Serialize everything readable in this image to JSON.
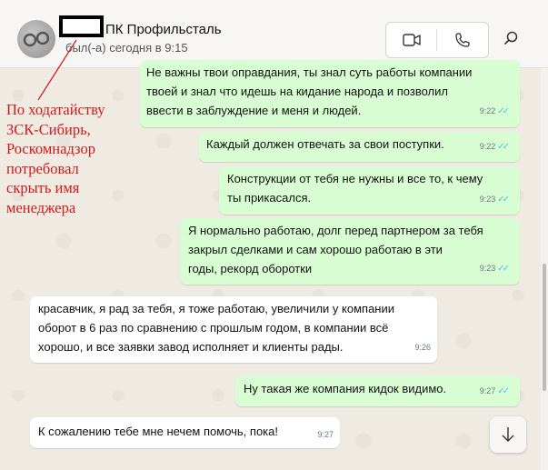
{
  "header": {
    "contact_name": "ПК Профильсталь",
    "status": "был(-а) сегодня в 9:15",
    "icons": [
      "video-call-icon",
      "voice-call-icon",
      "search-icon"
    ]
  },
  "annotation": {
    "lines": [
      "По ходатайству",
      "ЗСК-Сибирь,",
      "Роскомнадзор",
      "потребовал",
      "скрыть имя",
      "менеджера"
    ],
    "color": "#d11a1a"
  },
  "messages": [
    {
      "direction": "out",
      "lines": [
        "Не важны твои оправдания, ты знал суть работы компании",
        "твоей и знал что идешь на кидание народа и позволил",
        "ввести  в заблуждение и меня и людей."
      ],
      "time": "9:22",
      "ticks": "✓✓"
    },
    {
      "direction": "out",
      "lines": [
        "Каждый должен отвечать за свои поступки."
      ],
      "time": "9:22",
      "ticks": "✓✓"
    },
    {
      "direction": "out",
      "lines": [
        "Конструкции от тебя не нужны и все то, к чему",
        "ты прикасался."
      ],
      "time": "9:23",
      "ticks": "✓✓"
    },
    {
      "direction": "out",
      "lines": [
        "Я нормально работаю, долг перед партнером за тебя",
        "закрыл сделками и сам хорошо работаю в эти",
        "годы, рекорд оборотки"
      ],
      "time": "9:23",
      "ticks": "✓✓"
    },
    {
      "direction": "in",
      "lines": [
        "красавчик, я рад за тебя, я тоже работаю, увеличили у компании",
        "оборот в 6 раз по сравнению с прошлым годом, в компании всё",
        "хорошо, и все заявки завод исполняет и клиенты рады."
      ],
      "time": "9:26"
    },
    {
      "direction": "out",
      "lines": [
        "Ну такая же компания кидок видимо."
      ],
      "time": "9:27",
      "ticks": "✓✓"
    },
    {
      "direction": "in",
      "lines": [
        "К сожалению тебе мне нечем помочь, пока!"
      ],
      "time": "9:27"
    }
  ],
  "colors": {
    "outgoing_bubble": "#d9fdd3",
    "incoming_bubble": "#ffffff",
    "read_ticks": "#53bdeb"
  }
}
